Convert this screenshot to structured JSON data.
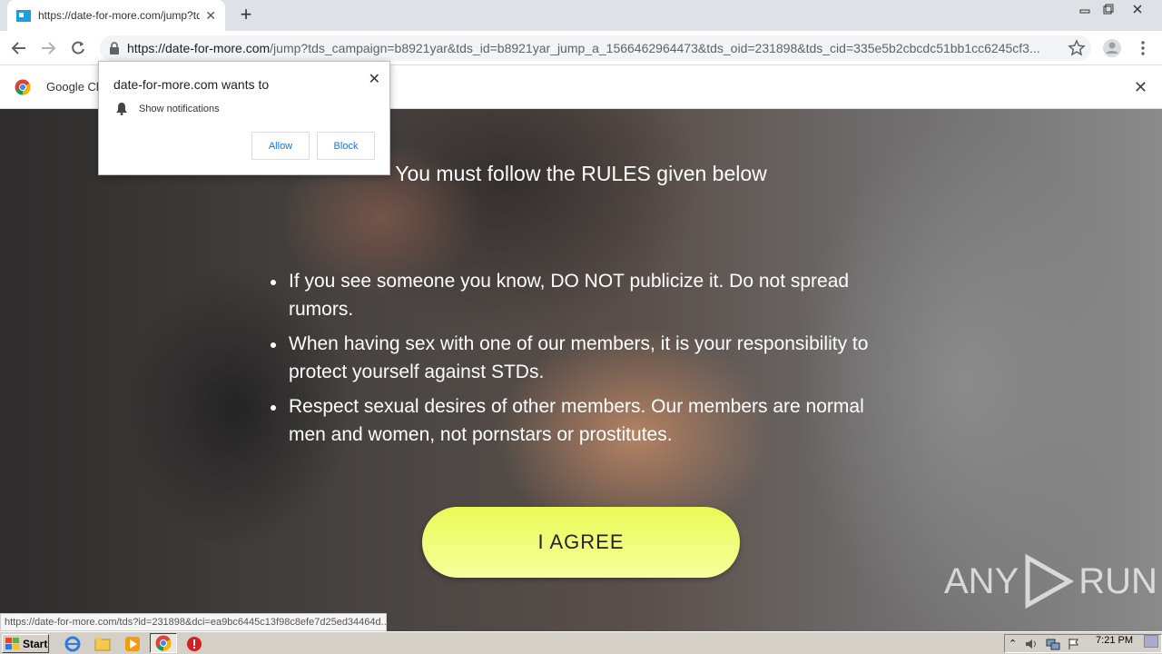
{
  "browser": {
    "tab_title": "https://date-for-more.com/jump?tds",
    "url_host": "https://date-for-more.com",
    "url_path": "/jump?tds_campaign=b8921yar&tds_id=b8921yar_jump_a_1566462964473&tds_oid=231898&tds_cid=335e5b2cbcdc51bb1cc6245cf3...",
    "infobar_text": "Google Ch"
  },
  "popup": {
    "title": "date-for-more.com wants to",
    "permission": "Show notifications",
    "allow_label": "Allow",
    "block_label": "Block"
  },
  "page": {
    "headline": "You must follow the RULES given below",
    "rules": [
      "If you see someone you know, DO NOT publicize it. Do not spread rumors.",
      "When having sex with one of our members, it is your responsibility to protect yourself against STDs.",
      "Respect sexual desires of other members. Our members are normal men and women, not pornstars or prostitutes."
    ],
    "agree_label": "I AGREE",
    "status_url": "https://date-for-more.com/tds?id=231898&dci=ea9bc6445c13f98c8efe7d25ed34464d..."
  },
  "watermark": {
    "left": "ANY",
    "right": "RUN"
  },
  "taskbar": {
    "start_label": "Start",
    "clock": "7:21 PM"
  },
  "colors": {
    "agree_button": "#eefb6e",
    "link_blue": "#1a73e8"
  }
}
